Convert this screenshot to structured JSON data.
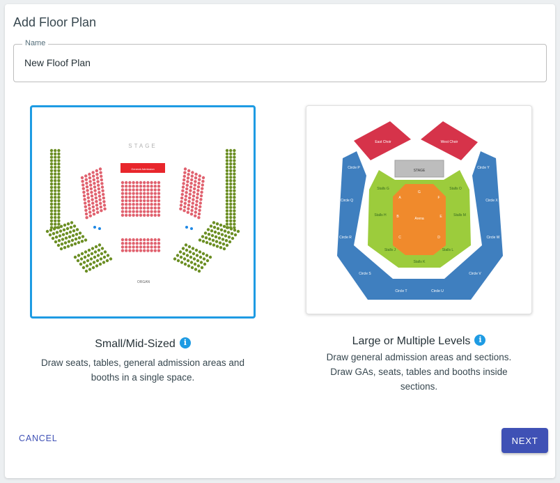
{
  "dialog": {
    "title": "Add Floor Plan"
  },
  "name_field": {
    "label": "Name",
    "value": "New Floof Plan"
  },
  "options": [
    {
      "title": "Small/Mid-Sized",
      "description_lines": [
        "Draw seats, tables, general admission areas and",
        "booths in a single space."
      ],
      "selected": true,
      "map": {
        "stage": "STAGE",
        "ga": "General Admission",
        "organ": "ORGAN"
      }
    },
    {
      "title": "Large or Multiple Levels",
      "description_lines": [
        "Draw general admission areas and sections.",
        "Draw GAs, seats, tables and booths inside",
        "sections."
      ],
      "selected": false,
      "map": {
        "stage": "STAGE",
        "east_choir": "East Choir",
        "west_choir": "West Choir",
        "circle_p": "Circle P",
        "circle_q": "Circle Q",
        "circle_r": "Circle R",
        "circle_s": "Circle S",
        "circle_t": "Circle T",
        "circle_u": "Circle U",
        "circle_v": "Circle V",
        "circle_w": "Circle W",
        "circle_x": "Circle X",
        "circle_y": "Circle Y",
        "stalls_g": "Stalls G",
        "stalls_h": "Stalls H",
        "stalls_j": "Stalls J",
        "stalls_k": "Stalls K",
        "stalls_l": "Stalls L",
        "stalls_m": "Stalls M",
        "stalls_o": "Stalls O",
        "arena": "Arena",
        "row_a": "A",
        "row_b": "B",
        "row_c": "C",
        "row_d": "D",
        "row_e": "E",
        "row_f": "F",
        "row_g": "G"
      }
    }
  ],
  "info_icon_glyph": "i",
  "actions": {
    "cancel": "CANCEL",
    "next": "NEXT"
  },
  "colors": {
    "accent": "#3f51b5",
    "selected_border": "#1e9be3",
    "seat_red": "#e0616e",
    "seat_green": "#6b8e23",
    "circle_blue": "#3f7fbf",
    "choir_red": "#d6334a",
    "stalls_green": "#9ccc3c",
    "arena_orange": "#f08a2c"
  }
}
